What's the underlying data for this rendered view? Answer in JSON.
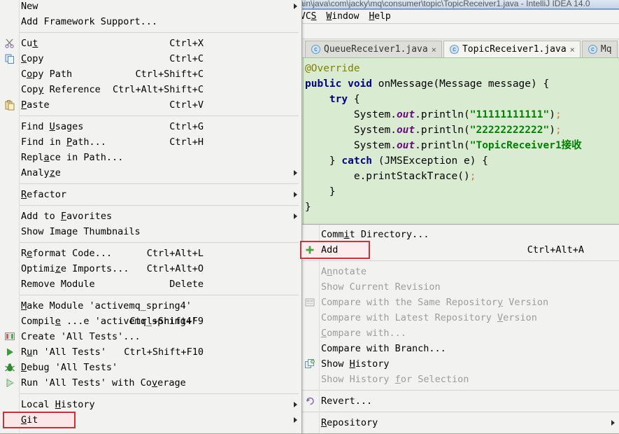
{
  "ide": {
    "title": "ain\\java\\com\\jacky\\mq\\consumer\\topic\\TopicReceiver1.java - IntelliJ IDEA 14.0",
    "menubar": [
      {
        "label": "VCS",
        "hotkey": "S"
      },
      {
        "label": "Window",
        "hotkey": "W"
      },
      {
        "label": "Help",
        "hotkey": "H"
      }
    ],
    "tabs": [
      {
        "label": "QueueReceiver1.java",
        "icon": "class-icon",
        "close": "×",
        "active": false
      },
      {
        "label": "TopicReceiver1.java",
        "icon": "class-icon",
        "close": "×",
        "active": true
      },
      {
        "label": "Mq",
        "icon": "class-icon",
        "close": "",
        "active": false
      }
    ],
    "code_lines": [
      [
        {
          "t": "@Override",
          "c": "ann"
        }
      ],
      [
        {
          "t": "public ",
          "c": "kw"
        },
        {
          "t": "void ",
          "c": "kw"
        },
        {
          "t": "onMessage(Message message) {",
          "c": "plain"
        }
      ],
      [
        {
          "t": "    ",
          "c": "plain"
        },
        {
          "t": "try ",
          "c": "kw"
        },
        {
          "t": "{",
          "c": "plain"
        }
      ],
      [
        {
          "t": "        System.",
          "c": "plain"
        },
        {
          "t": "out",
          "c": "fld"
        },
        {
          "t": ".println(",
          "c": "plain"
        },
        {
          "t": "\"11111111111\"",
          "c": "str"
        },
        {
          "t": ")",
          "c": "plain"
        },
        {
          "t": ";",
          "c": "semi"
        }
      ],
      [
        {
          "t": "        System.",
          "c": "plain"
        },
        {
          "t": "out",
          "c": "fld"
        },
        {
          "t": ".println(",
          "c": "plain"
        },
        {
          "t": "\"22222222222\"",
          "c": "str"
        },
        {
          "t": ")",
          "c": "plain"
        },
        {
          "t": ";",
          "c": "semi"
        }
      ],
      [
        {
          "t": "        System.",
          "c": "plain"
        },
        {
          "t": "out",
          "c": "fld"
        },
        {
          "t": ".println(",
          "c": "plain"
        },
        {
          "t": "\"TopicReceiver1接收",
          "c": "str"
        }
      ],
      [
        {
          "t": "    } ",
          "c": "plain"
        },
        {
          "t": "catch ",
          "c": "kw"
        },
        {
          "t": "(JMSException e) {",
          "c": "plain"
        }
      ],
      [
        {
          "t": "        e.printStackTrace()",
          "c": "plain"
        },
        {
          "t": ";",
          "c": "semi"
        }
      ],
      [
        {
          "t": "    }",
          "c": "plain"
        }
      ],
      [
        {
          "t": "}",
          "c": "plain"
        }
      ]
    ]
  },
  "context_menu": {
    "groups": [
      {
        "items": [
          {
            "label": "New",
            "hotkey": "",
            "accel": "",
            "submenu": true,
            "icon": "",
            "disabled": false
          },
          {
            "label": "Add Framework Support...",
            "hotkey": "",
            "accel": "",
            "submenu": false,
            "icon": "",
            "disabled": false
          }
        ]
      },
      {
        "items": [
          {
            "label": "Cut",
            "hotkey": "t",
            "accel": "Ctrl+X",
            "submenu": false,
            "icon": "scissors-icon",
            "disabled": false
          },
          {
            "label": "Copy",
            "hotkey": "C",
            "accel": "Ctrl+C",
            "submenu": false,
            "icon": "copy-icon",
            "disabled": false
          },
          {
            "label": "Copy Path",
            "hotkey": "o",
            "accel": "Ctrl+Shift+C",
            "submenu": false,
            "icon": "",
            "disabled": false
          },
          {
            "label": "Copy Reference",
            "hotkey": "y",
            "accel": "Ctrl+Alt+Shift+C",
            "submenu": false,
            "icon": "",
            "disabled": false
          },
          {
            "label": "Paste",
            "hotkey": "P",
            "accel": "Ctrl+V",
            "submenu": false,
            "icon": "paste-icon",
            "disabled": false
          }
        ]
      },
      {
        "items": [
          {
            "label": "Find Usages",
            "hotkey": "U",
            "accel": "Ctrl+G",
            "submenu": false,
            "icon": "",
            "disabled": false
          },
          {
            "label": "Find in Path...",
            "hotkey": "P",
            "accel": "Ctrl+H",
            "submenu": false,
            "icon": "",
            "disabled": false
          },
          {
            "label": "Replace in Path...",
            "hotkey": "a",
            "accel": "",
            "submenu": false,
            "icon": "",
            "disabled": false
          },
          {
            "label": "Analyze",
            "hotkey": "z",
            "accel": "",
            "submenu": true,
            "icon": "",
            "disabled": false
          }
        ]
      },
      {
        "items": [
          {
            "label": "Refactor",
            "hotkey": "R",
            "accel": "",
            "submenu": true,
            "icon": "",
            "disabled": false
          }
        ]
      },
      {
        "items": [
          {
            "label": "Add to Favorites",
            "hotkey": "F",
            "accel": "",
            "submenu": true,
            "icon": "",
            "disabled": false
          },
          {
            "label": "Show Image Thumbnails",
            "hotkey": "",
            "accel": "",
            "submenu": false,
            "icon": "",
            "disabled": false
          }
        ]
      },
      {
        "items": [
          {
            "label": "Reformat Code...",
            "hotkey": "e",
            "accel": "Ctrl+Alt+L",
            "submenu": false,
            "icon": "",
            "disabled": false
          },
          {
            "label": "Optimize Imports...",
            "hotkey": "z",
            "accel": "Ctrl+Alt+O",
            "submenu": false,
            "icon": "",
            "disabled": false
          },
          {
            "label": "Remove Module",
            "hotkey": "",
            "accel": "Delete",
            "submenu": false,
            "icon": "",
            "disabled": false
          }
        ]
      },
      {
        "items": [
          {
            "label": "Make Module 'activemq_spring4'",
            "hotkey": "M",
            "accel": "",
            "submenu": false,
            "icon": "",
            "disabled": false
          },
          {
            "label": "Compile ...e 'activemq_spring4'",
            "hotkey": "e",
            "accel": "Ctrl+Shift+F9",
            "submenu": false,
            "icon": "",
            "disabled": false
          },
          {
            "label": "Create 'All Tests'...",
            "hotkey": "",
            "accel": "",
            "submenu": false,
            "icon": "test-config-icon",
            "disabled": false
          },
          {
            "label": "Run 'All Tests'",
            "hotkey": "u",
            "accel": "Ctrl+Shift+F10",
            "submenu": false,
            "icon": "run-icon",
            "disabled": false
          },
          {
            "label": "Debug 'All Tests'",
            "hotkey": "D",
            "accel": "",
            "submenu": false,
            "icon": "debug-icon",
            "disabled": false
          },
          {
            "label": "Run 'All Tests' with Coverage",
            "hotkey": "v",
            "accel": "",
            "submenu": false,
            "icon": "coverage-icon",
            "disabled": false
          }
        ]
      },
      {
        "items": [
          {
            "label": "Local History",
            "hotkey": "H",
            "accel": "",
            "submenu": true,
            "icon": "",
            "disabled": false
          },
          {
            "label": "Git",
            "hotkey": "G",
            "accel": "",
            "submenu": true,
            "icon": "",
            "disabled": false,
            "highlighted": true
          }
        ]
      }
    ]
  },
  "vcs_menu": {
    "groups": [
      {
        "items": [
          {
            "label": "Commit Directory...",
            "hotkey": "i",
            "accel": "",
            "icon": "",
            "disabled": false
          },
          {
            "label": "Add",
            "hotkey": "",
            "accel": "Ctrl+Alt+A",
            "icon": "plus-icon",
            "disabled": false,
            "highlighted": true
          }
        ]
      },
      {
        "items": [
          {
            "label": "Annotate",
            "hotkey": "n",
            "accel": "",
            "icon": "",
            "disabled": true
          },
          {
            "label": "Show Current Revision",
            "hotkey": "",
            "accel": "",
            "icon": "",
            "disabled": true
          },
          {
            "label": "Compare with the Same Repository Version",
            "hotkey": "y",
            "accel": "",
            "icon": "repo-compare-icon",
            "disabled": true
          },
          {
            "label": "Compare with Latest Repository Version",
            "hotkey": "V",
            "accel": "",
            "icon": "",
            "disabled": true
          },
          {
            "label": "Compare with...",
            "hotkey": "C",
            "accel": "",
            "icon": "",
            "disabled": true
          },
          {
            "label": "Compare with Branch...",
            "hotkey": "",
            "accel": "",
            "icon": "",
            "disabled": false
          },
          {
            "label": "Show History",
            "hotkey": "H",
            "accel": "",
            "icon": "history-icon",
            "disabled": false
          },
          {
            "label": "Show History for Selection",
            "hotkey": "f",
            "accel": "",
            "icon": "",
            "disabled": true
          }
        ]
      },
      {
        "items": [
          {
            "label": "Revert...",
            "hotkey": "",
            "accel": "",
            "icon": "revert-icon",
            "disabled": false
          }
        ]
      },
      {
        "items": [
          {
            "label": "Repository",
            "hotkey": "R",
            "accel": "",
            "icon": "",
            "submenu": true,
            "disabled": false
          }
        ]
      }
    ]
  },
  "colors": {
    "menu_bg": "#f2f2f0",
    "code_bg": "#d9ecd2",
    "highlight_border": "#d0333a",
    "highlight_fill": "#fdeced",
    "disabled_text": "#9c9c99",
    "keyword": "#000080",
    "string": "#008000",
    "annotation": "#808000",
    "field": "#660e7a"
  }
}
